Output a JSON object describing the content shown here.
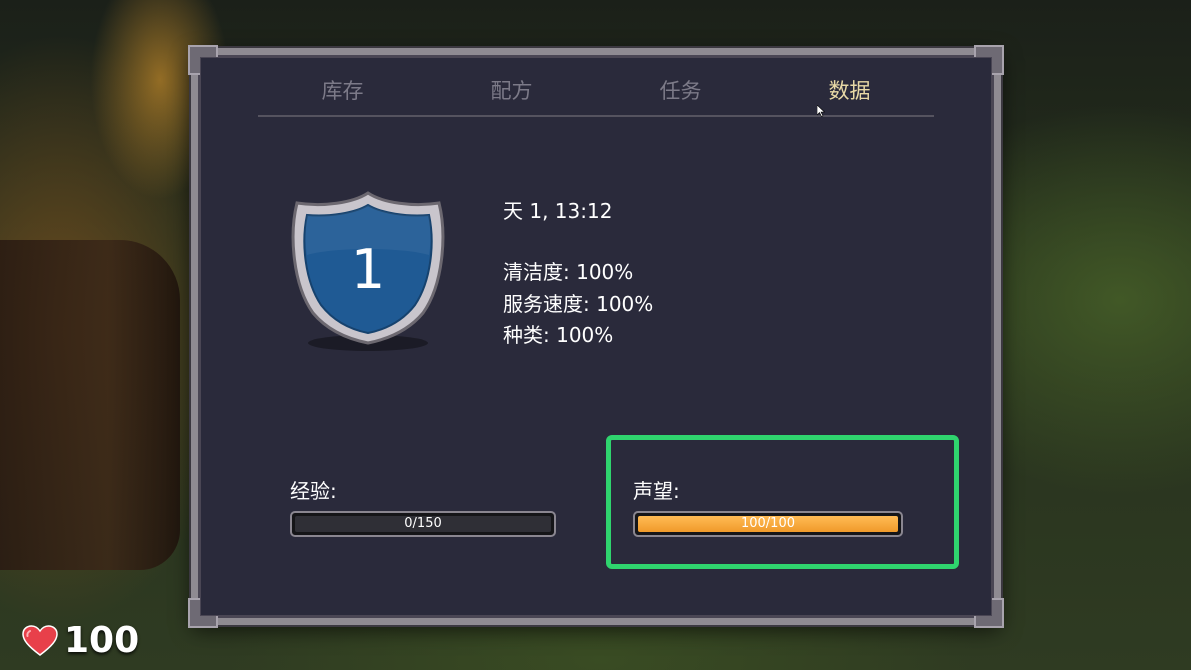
{
  "tabs": [
    {
      "label": "库存"
    },
    {
      "label": "配方"
    },
    {
      "label": "任务"
    },
    {
      "label": "数据"
    }
  ],
  "active_tab": "数据",
  "level_badge": {
    "value": "1",
    "icon": "shield-icon"
  },
  "stats": {
    "time": "天 1, 13:12",
    "cleanliness": "清洁度: 100%",
    "service_speed": "服务速度: 100%",
    "variety": "种类: 100%"
  },
  "experience": {
    "label": "经验:",
    "text": "0/150",
    "progress": 0.0
  },
  "reputation": {
    "label": "声望:",
    "text": "100/100",
    "progress": 1.0
  },
  "health": {
    "value": "100",
    "icon": "heart-icon"
  },
  "colors": {
    "panel_bg": "#2a2a3b",
    "active_tab": "#e8d9a6",
    "inactive_tab": "#7c7a88",
    "shield_blue": "#1f5a94",
    "reputation_fill": "#f4a43a",
    "highlight": "#2fd46e",
    "heart": "#e8404a"
  }
}
